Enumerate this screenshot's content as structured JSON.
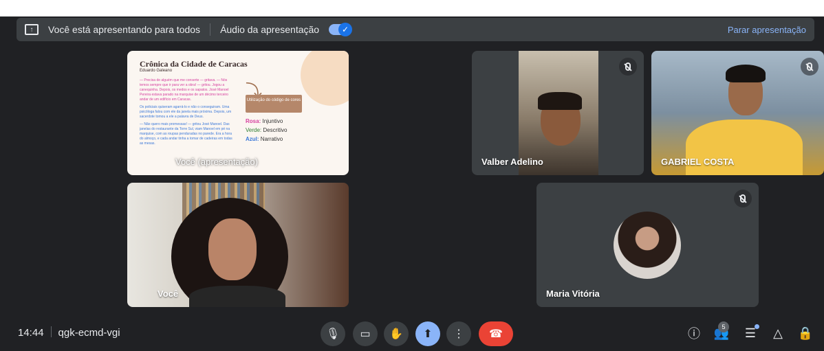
{
  "banner": {
    "presenting_text": "Você está apresentando para todos",
    "audio_label": "Áudio da apresentação",
    "audio_enabled": true,
    "stop_label": "Parar apresentação"
  },
  "slide": {
    "title": "Crônica da Cidade de Caracas",
    "author": "Eduardo Galeano",
    "body_1": "— Precisa de alguém que me conserte — gritava. — Nós temos sempre que ir para ver a obra! — gritou. Jogou a canequinha. Depois, os medos e os sapatos. José Manoel Pereira estava parado na marquise de um décimo terceiro andar de um edifício em Caracas.",
    "body_2": "Os policiais quiseram agarrá-lo e não o conseguiram. Uma psicóloga falou com ele da janela mais próxima. Depois, um sacerdote tomou a ele a palavra de Deus.",
    "body_3": "— Não quero mais promessas! — gritou José Manoel. Das janelas do restaurante da Torre Sul, viam Manoel em pé na marquise, com as roupas penduradas no parede. Era a hora do almoço, e cada andar tinha a tomar de cadeiras em todas as mesas.",
    "code_box": "Utilização do código de cores",
    "legend_rosa": "Rosa:",
    "legend_rosa_val": "Injuntivo",
    "legend_verde": "Verde:",
    "legend_verde_val": "Descritivo",
    "legend_azul": "Azul:",
    "legend_azul_val": "Narrativo",
    "label": "Você (apresentação)"
  },
  "participants": {
    "valber": "Valber Adelino",
    "gabriel": "GABRIEL COSTA",
    "voce": "Você",
    "maria": "Maria Vitória"
  },
  "meeting": {
    "time": "14:44",
    "code": "qgk-ecmd-vgi",
    "people_count": "5"
  },
  "colors": {
    "accent": "#8ab4f8",
    "end_call": "#ea4335",
    "background": "#202124",
    "tile": "#3c4043"
  },
  "icons": [
    "present-screen-icon",
    "toggle-check-icon",
    "mic-off-icon",
    "mic-icon",
    "camera-icon",
    "raise-hand-icon",
    "present-now-icon",
    "more-options-icon",
    "end-call-icon",
    "info-icon",
    "people-icon",
    "chat-icon",
    "activities-icon",
    "host-controls-icon"
  ]
}
